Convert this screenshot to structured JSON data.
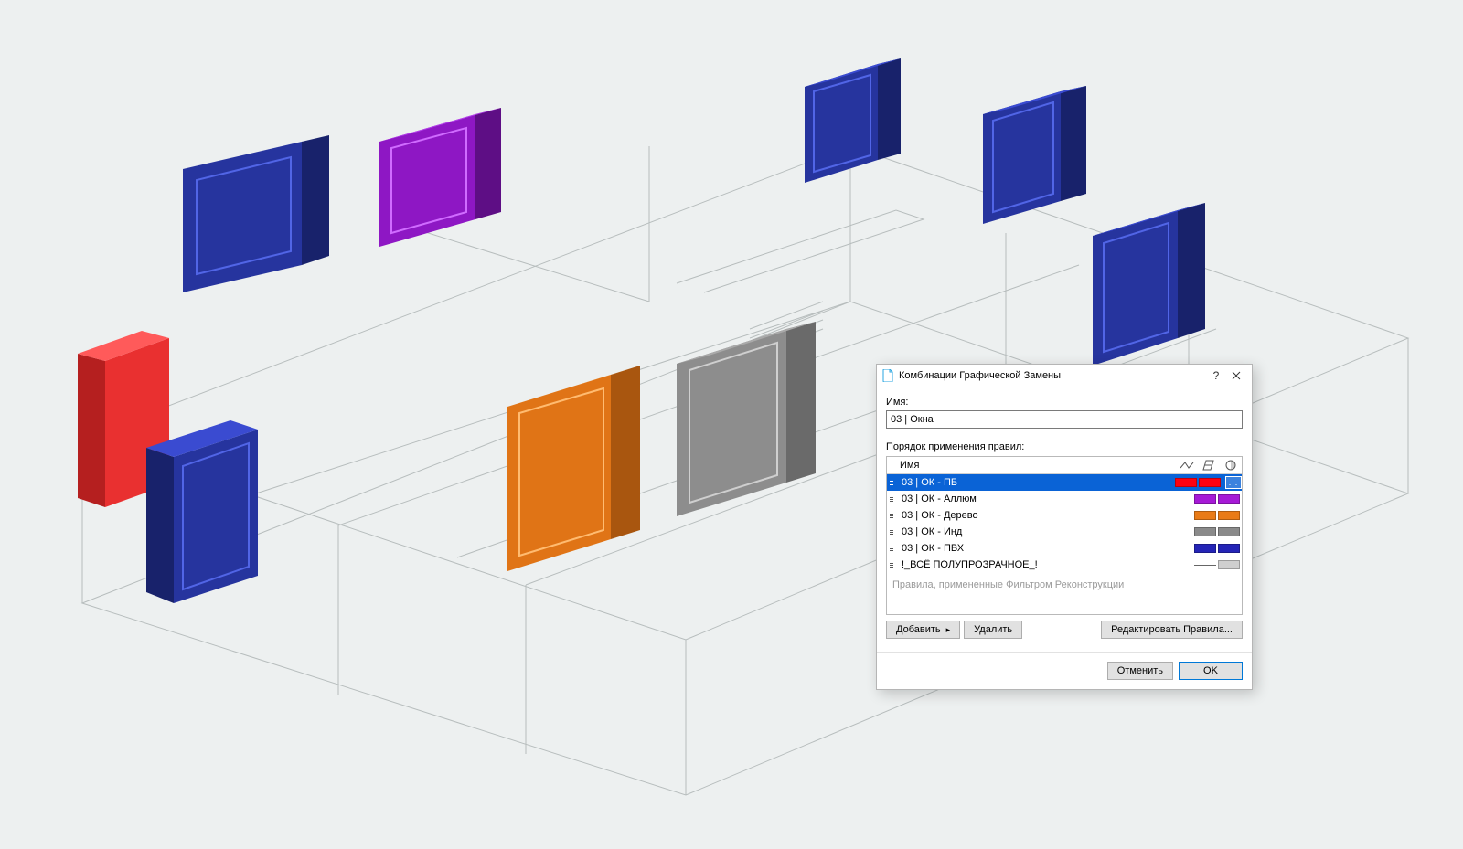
{
  "dialog": {
    "title": "Комбинации Графической Замены",
    "name_label": "Имя:",
    "name_value": "03 | Окна",
    "order_label": "Порядок применения правил:",
    "col_name": "Имя",
    "note": "Правила, примененные Фильтром Реконструкции",
    "add": "Добавить",
    "remove": "Удалить",
    "edit": "Редактировать Правила...",
    "cancel": "Отменить",
    "ok": "OK",
    "more": "...",
    "rules": [
      {
        "name": "03 | ОК - ПБ",
        "sw1": "#ff0010",
        "sw2": "#ff0010",
        "selected": true,
        "more": true
      },
      {
        "name": "03 | ОК - Аллюм",
        "sw1": "#a61ad6",
        "sw2": "#a61ad6",
        "selected": false,
        "more": false
      },
      {
        "name": "03 | ОК - Дерево",
        "sw1": "#e97b17",
        "sw2": "#e97b17",
        "selected": false,
        "more": false
      },
      {
        "name": "03 | ОК - Инд",
        "sw1": "#8a8a8a",
        "sw2": "#8a8a8a",
        "selected": false,
        "more": false
      },
      {
        "name": "03 | ОК - ПВХ",
        "sw1": "#2424b6",
        "sw2": "#2424b6",
        "selected": false,
        "more": false
      },
      {
        "name": "!_ВСЁ ПОЛУПРОЗРАЧНОЕ_!",
        "lineOnly": true,
        "sw2": "#cfcfcf",
        "selected": false,
        "more": false
      }
    ]
  },
  "scene": {
    "windows": [
      {
        "color": "#2e3db2"
      },
      {
        "color": "#a61ad6"
      },
      {
        "color": "#2e3db2"
      },
      {
        "color": "#2e3db2"
      },
      {
        "color": "#ff2a2a"
      },
      {
        "color": "#2e3db2"
      },
      {
        "color": "#e97b17"
      },
      {
        "color": "#8a8a8a"
      },
      {
        "color": "#2e3db2"
      }
    ]
  }
}
